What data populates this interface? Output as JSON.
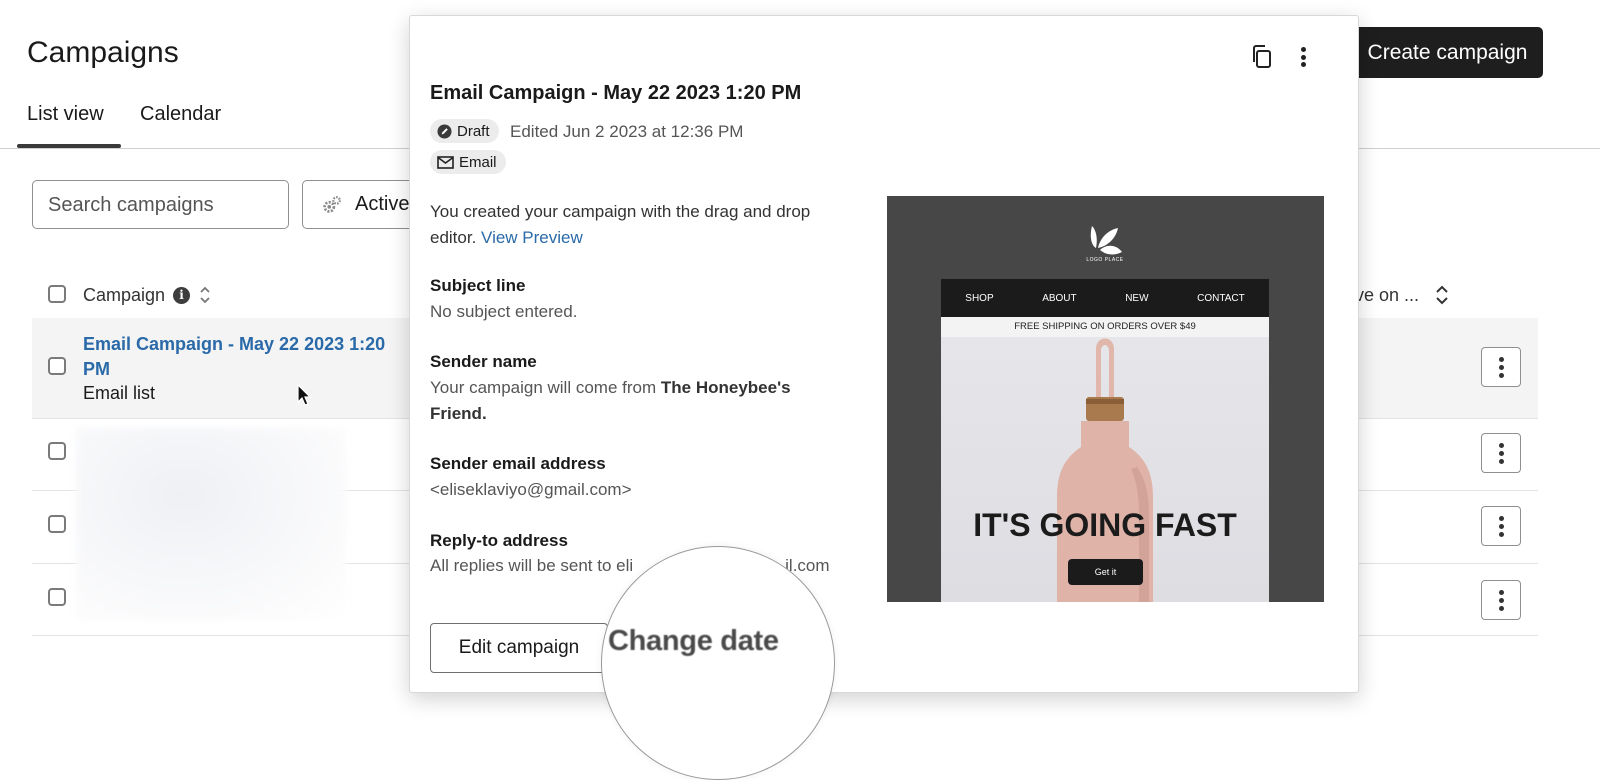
{
  "header": {
    "title": "Campaigns",
    "create_button": "Create campaign",
    "tabs": [
      {
        "label": "List view",
        "active": true
      },
      {
        "label": "Calendar",
        "active": false
      }
    ]
  },
  "toolbar": {
    "search_placeholder": "Search campaigns",
    "filter_label": "Active"
  },
  "table": {
    "columns": [
      "Campaign",
      "ve on ..."
    ],
    "rows": [
      {
        "title": "Email Campaign - May 22 2023 1:20 PM",
        "subtitle": "Email list"
      }
    ]
  },
  "panel": {
    "title": "Email Campaign - May 22 2023 1:20 PM",
    "status_badge": "Draft",
    "edited": "Edited Jun 2 2023 at 12:36 PM",
    "channel_badge": "Email",
    "created_text": "You created your campaign with the drag and drop editor.",
    "view_preview": "View Preview",
    "subject_label": "Subject line",
    "subject_value": "No subject entered.",
    "sender_name_label": "Sender name",
    "sender_name_prefix": "Your campaign will come from",
    "sender_name_value": "The Honeybee's Friend.",
    "sender_email_label": "Sender email address",
    "sender_email_value": "<eliseklaviyo@gmail.com>",
    "reply_label": "Reply-to address",
    "reply_value_start": "All replies will be sent to eli",
    "reply_value_end": "il.com",
    "edit_button": "Edit campaign",
    "change_date": "Change date"
  },
  "preview": {
    "logo_text": "LOGO PLACE",
    "nav": [
      "SHOP",
      "ABOUT",
      "NEW",
      "CONTACT"
    ],
    "shipping": "FREE SHIPPING ON ORDERS OVER $49",
    "headline": "IT'S GOING FAST",
    "cta": "Get it"
  },
  "colors": {
    "link": "#2a6aa8",
    "dark_button": "#1e1e1e",
    "preview_bg": "#474747",
    "bottle": "#dfb3a8"
  }
}
